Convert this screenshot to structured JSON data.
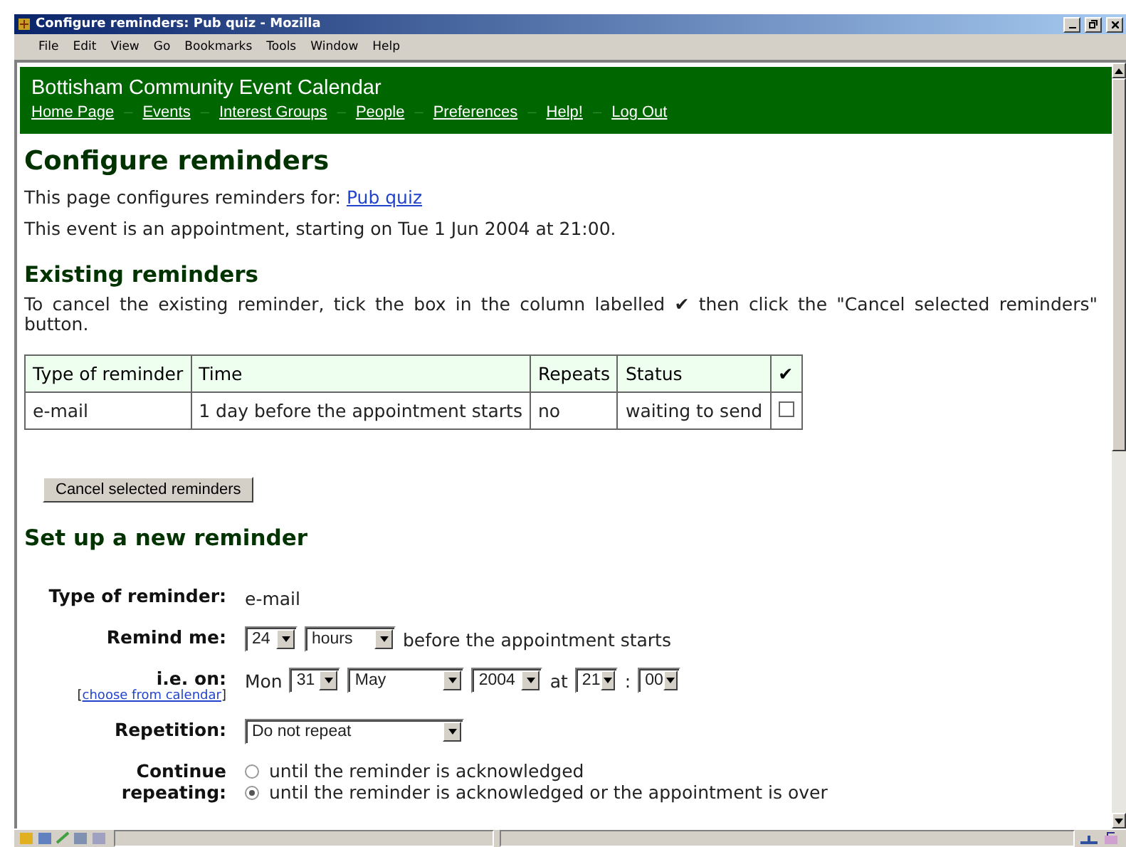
{
  "window": {
    "title": "Configure reminders: Pub quiz - Mozilla"
  },
  "menu": [
    "File",
    "Edit",
    "View",
    "Go",
    "Bookmarks",
    "Tools",
    "Window",
    "Help"
  ],
  "site": {
    "title": "Bottisham Community Event Calendar",
    "separator": "–",
    "nav": [
      "Home Page",
      "Events",
      "Interest Groups",
      "People",
      "Preferences",
      "Help!",
      "Log Out"
    ]
  },
  "page": {
    "heading": "Configure reminders",
    "intro_label": "This page configures reminders for:",
    "intro_link": "Pub quiz",
    "event_info": "This event is an appointment, starting on Tue 1 Jun 2004 at 21:00."
  },
  "existing": {
    "heading": "Existing reminders",
    "instructions": "To cancel the existing reminder, tick the box in the column labelled ✔ then click the \"Cancel selected reminders\" button.",
    "columns": [
      "Type of reminder",
      "Time",
      "Repeats",
      "Status",
      "✔"
    ],
    "rows": [
      {
        "cells": [
          "e-mail",
          "1 day before the appointment starts",
          "no",
          "waiting to send"
        ],
        "checked": false
      }
    ],
    "button": "Cancel selected reminders"
  },
  "new_reminder": {
    "heading": "Set up a new reminder",
    "rows": [
      {
        "label": "Type of reminder:",
        "kind": "text",
        "value": "e-mail"
      },
      {
        "label": "Remind me:",
        "kind": "controls",
        "items": [
          {
            "kind": "select",
            "value": "24"
          },
          {
            "kind": "select",
            "value": "hours"
          },
          {
            "kind": "text",
            "value": "before the appointment starts"
          }
        ]
      },
      {
        "label": "i.e. on:",
        "link_open": "[",
        "link": "choose from calendar",
        "link_close": "]",
        "kind": "controls",
        "items": [
          {
            "kind": "text",
            "value": "Mon"
          },
          {
            "kind": "select",
            "value": "31"
          },
          {
            "kind": "select",
            "value": "May"
          },
          {
            "kind": "select",
            "value": "2004"
          },
          {
            "kind": "text",
            "value": "at"
          },
          {
            "kind": "select",
            "value": "21"
          },
          {
            "kind": "text",
            "value": ":"
          },
          {
            "kind": "select",
            "value": "00"
          }
        ]
      },
      {
        "label": "Repetition:",
        "kind": "controls",
        "items": [
          {
            "kind": "select",
            "value": "Do not repeat"
          }
        ]
      },
      {
        "label": "Continue repeating:",
        "kind": "radios",
        "options": [
          {
            "label": "until the reminder is acknowledged",
            "selected": false
          },
          {
            "label": "until the reminder is acknowledged or the appointment is over",
            "selected": true
          }
        ]
      }
    ]
  }
}
